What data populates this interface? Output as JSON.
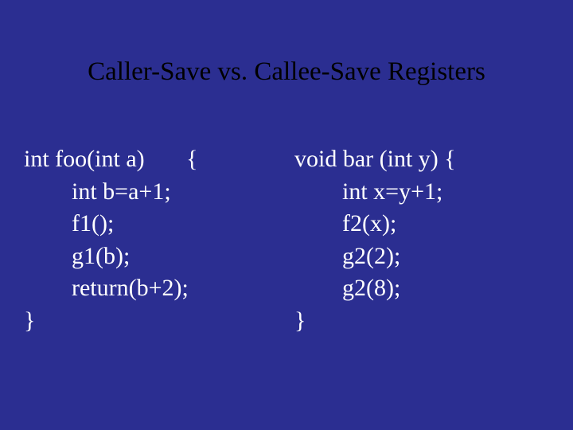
{
  "title": "Caller-Save vs.  Callee-Save Registers",
  "left": {
    "sig": "int foo(int a)       {",
    "l1": "int b=a+1;",
    "l2": "f1();",
    "l3": "g1(b);",
    "l4": "return(b+2);",
    "close": "}"
  },
  "right": {
    "sig": "void bar (int y) {",
    "l1": "int x=y+1;",
    "l2": "f2(x);",
    "l3": "g2(2);",
    "l4": "g2(8);",
    "close": "}"
  }
}
